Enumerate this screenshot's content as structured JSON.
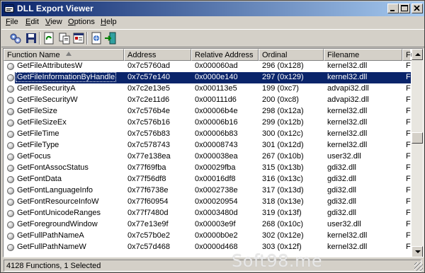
{
  "window": {
    "title": "DLL Export Viewer",
    "icon": "dll-export-viewer-icon",
    "controls": [
      "minimize",
      "maximize",
      "close"
    ]
  },
  "menu": [
    {
      "label": "File",
      "underline": "F",
      "rest": "ile"
    },
    {
      "label": "Edit",
      "underline": "E",
      "rest": "dit"
    },
    {
      "label": "View",
      "underline": "V",
      "rest": "iew"
    },
    {
      "label": "Options",
      "underline": "O",
      "rest": "ptions"
    },
    {
      "label": "Help",
      "underline": "H",
      "rest": "elp"
    }
  ],
  "toolbar": {
    "buttons": [
      "select-dlls-icon",
      "save-icon",
      "refresh-icon",
      "copy-icon",
      "properties-icon",
      "html-report-icon",
      "exit-icon"
    ]
  },
  "list": {
    "columns": [
      "Function Name",
      "Address",
      "Relative Address",
      "Ordinal",
      "Filename",
      "Fu"
    ],
    "rows": [
      {
        "name": "GetFileAttributesW",
        "address": "0x7c5760ad",
        "relative": "0x000060ad",
        "ordinal": "296 (0x128)",
        "filename": "kernel32.dll",
        "fu": "Fu"
      },
      {
        "name": "GetFileInformationByHandle",
        "address": "0x7c57e140",
        "relative": "0x0000e140",
        "ordinal": "297 (0x129)",
        "filename": "kernel32.dll",
        "fu": "Fu"
      },
      {
        "name": "GetFileSecurityA",
        "address": "0x7c2e13e5",
        "relative": "0x000113e5",
        "ordinal": "199 (0xc7)",
        "filename": "advapi32.dll",
        "fu": "Fu"
      },
      {
        "name": "GetFileSecurityW",
        "address": "0x7c2e11d6",
        "relative": "0x000111d6",
        "ordinal": "200 (0xc8)",
        "filename": "advapi32.dll",
        "fu": "Fu"
      },
      {
        "name": "GetFileSize",
        "address": "0x7c576b4e",
        "relative": "0x00006b4e",
        "ordinal": "298 (0x12a)",
        "filename": "kernel32.dll",
        "fu": "Fu"
      },
      {
        "name": "GetFileSizeEx",
        "address": "0x7c576b16",
        "relative": "0x00006b16",
        "ordinal": "299 (0x12b)",
        "filename": "kernel32.dll",
        "fu": "Fu"
      },
      {
        "name": "GetFileTime",
        "address": "0x7c576b83",
        "relative": "0x00006b83",
        "ordinal": "300 (0x12c)",
        "filename": "kernel32.dll",
        "fu": "Fu"
      },
      {
        "name": "GetFileType",
        "address": "0x7c578743",
        "relative": "0x00008743",
        "ordinal": "301 (0x12d)",
        "filename": "kernel32.dll",
        "fu": "Fu"
      },
      {
        "name": "GetFocus",
        "address": "0x77e138ea",
        "relative": "0x000038ea",
        "ordinal": "267 (0x10b)",
        "filename": "user32.dll",
        "fu": "Fu"
      },
      {
        "name": "GetFontAssocStatus",
        "address": "0x77f69fba",
        "relative": "0x00029fba",
        "ordinal": "315 (0x13b)",
        "filename": "gdi32.dll",
        "fu": "Fu"
      },
      {
        "name": "GetFontData",
        "address": "0x77f56df8",
        "relative": "0x00016df8",
        "ordinal": "316 (0x13c)",
        "filename": "gdi32.dll",
        "fu": "Fu"
      },
      {
        "name": "GetFontLanguageInfo",
        "address": "0x77f6738e",
        "relative": "0x0002738e",
        "ordinal": "317 (0x13d)",
        "filename": "gdi32.dll",
        "fu": "Fu"
      },
      {
        "name": "GetFontResourceInfoW",
        "address": "0x77f60954",
        "relative": "0x00020954",
        "ordinal": "318 (0x13e)",
        "filename": "gdi32.dll",
        "fu": "Fu"
      },
      {
        "name": "GetFontUnicodeRanges",
        "address": "0x77f7480d",
        "relative": "0x0003480d",
        "ordinal": "319 (0x13f)",
        "filename": "gdi32.dll",
        "fu": "Fu"
      },
      {
        "name": "GetForegroundWindow",
        "address": "0x77e13e9f",
        "relative": "0x00003e9f",
        "ordinal": "268 (0x10c)",
        "filename": "user32.dll",
        "fu": "Fu"
      },
      {
        "name": "GetFullPathNameA",
        "address": "0x7c57b0e2",
        "relative": "0x0000b0e2",
        "ordinal": "302 (0x12e)",
        "filename": "kernel32.dll",
        "fu": "Fu"
      },
      {
        "name": "GetFullPathNameW",
        "address": "0x7c57d468",
        "relative": "0x0000d468",
        "ordinal": "303 (0x12f)",
        "filename": "kernel32.dll",
        "fu": "Fu"
      }
    ],
    "selected_row": 1
  },
  "status": {
    "text": "4128 Functions, 1 Selected"
  },
  "watermark": {
    "text": "Soft98.me"
  }
}
